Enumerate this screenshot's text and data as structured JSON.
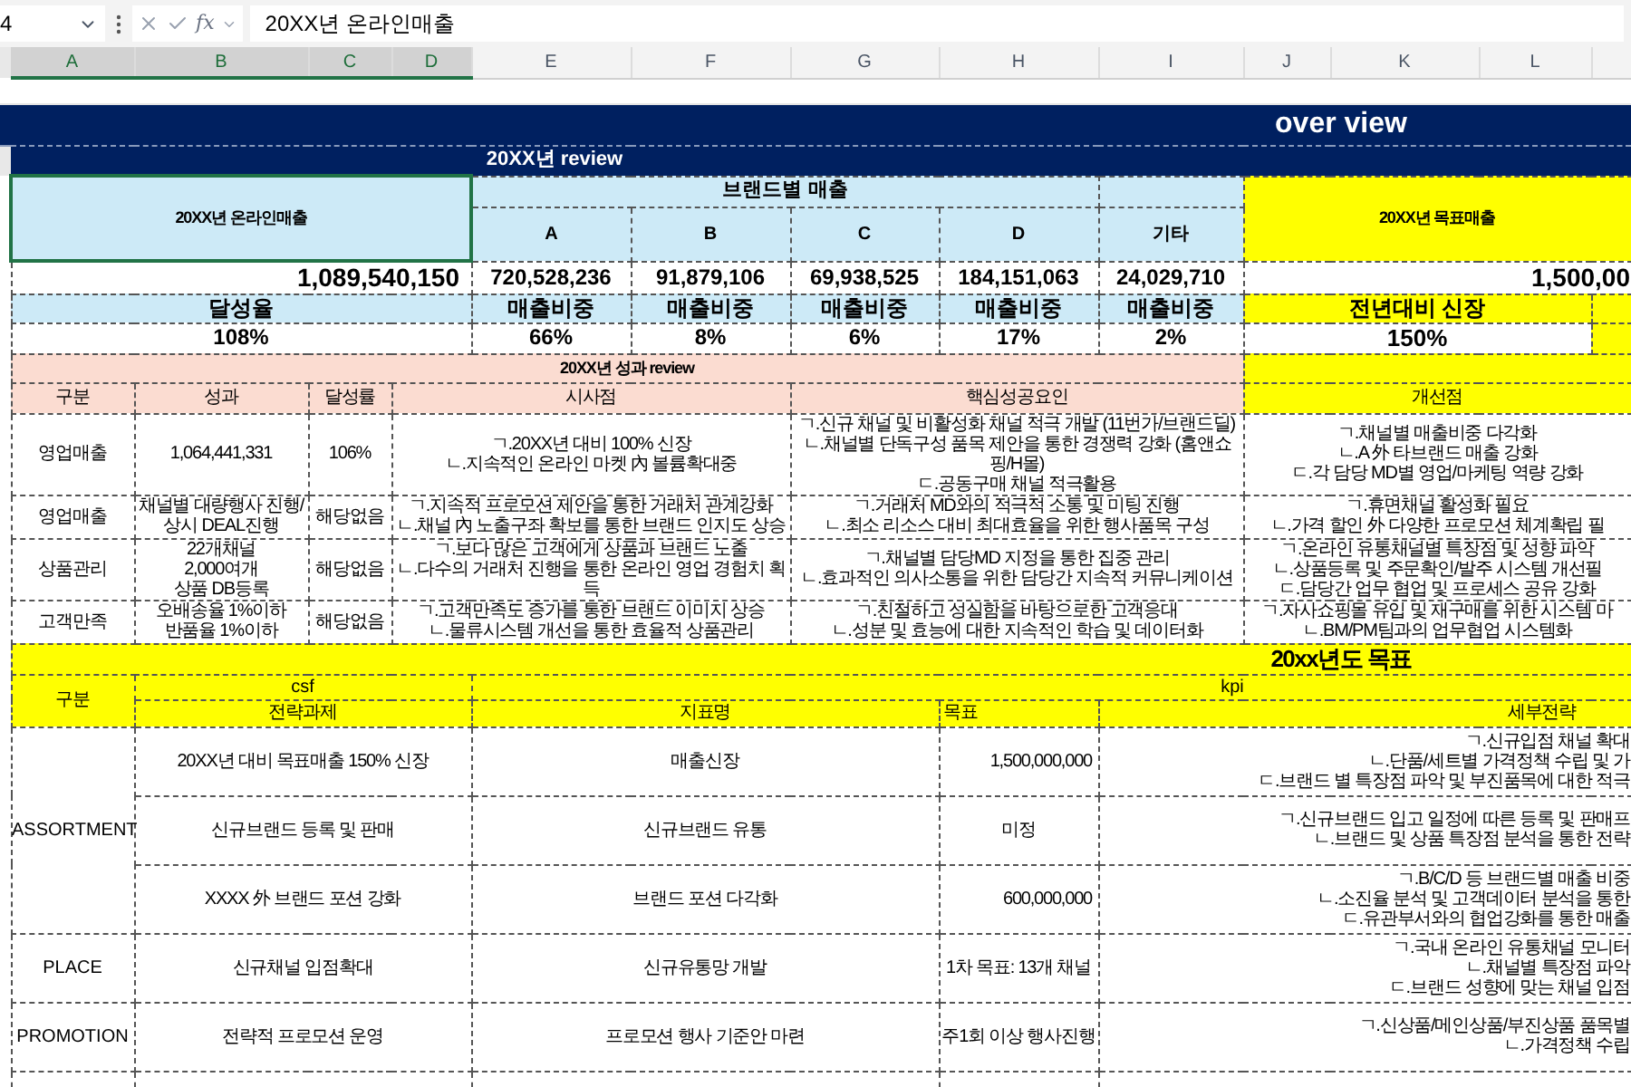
{
  "formula_bar": {
    "name_box": "4",
    "function_label": "fx",
    "formula": "20XX년 온라인매출"
  },
  "columns": [
    {
      "label": "A",
      "selected": true
    },
    {
      "label": "B",
      "selected": true
    },
    {
      "label": "C",
      "selected": true
    },
    {
      "label": "D",
      "selected": true
    },
    {
      "label": "E",
      "selected": false
    },
    {
      "label": "F",
      "selected": false
    },
    {
      "label": "G",
      "selected": false
    },
    {
      "label": "H",
      "selected": false
    },
    {
      "label": "I",
      "selected": false
    },
    {
      "label": "J",
      "selected": false
    },
    {
      "label": "K",
      "selected": false
    },
    {
      "label": "L",
      "selected": false
    }
  ],
  "overview": {
    "title": "over view"
  },
  "review": {
    "title": "20XX년 review",
    "sales_label": {
      "text": "20XX년 온라인매출",
      "selected": true
    },
    "brand_group": "브랜드별 매출",
    "total_sales": "1,089,540,150",
    "achievement_label": "달성율",
    "achievement": "108%",
    "target_label": "20XX년 목표매출",
    "target_sales": "1,500,00",
    "growth_label": "전년대비 신장",
    "growth": "150%",
    "brands": [
      {
        "name": "A",
        "sales": "720,528,236",
        "share_label": "매출비중",
        "share": "66%"
      },
      {
        "name": "B",
        "sales": "91,879,106",
        "share_label": "매출비중",
        "share": "8%"
      },
      {
        "name": "C",
        "sales": "69,938,525",
        "share_label": "매출비중",
        "share": "6%"
      },
      {
        "name": "D",
        "sales": "184,151,063",
        "share_label": "매출비중",
        "share": "17%"
      },
      {
        "name": "기타",
        "sales": "24,029,710",
        "share_label": "매출비중",
        "share": "2%"
      }
    ]
  },
  "performance": {
    "title": "20XX년 성과 review",
    "columns": [
      "구분",
      "성과",
      "달성률",
      "시사점",
      "핵심성공요인",
      "개선점"
    ],
    "rows": [
      {
        "category": "영업매출",
        "result": [
          "1,064,441,331"
        ],
        "rate": "106%",
        "implications": [
          "ㄱ.20XX년 대비 100% 신장",
          "ㄴ.지속적인 온라인 마켓 內 볼륨확대중"
        ],
        "success_factors": [
          "ㄱ.신규 채널 및 비활성화 채널  적극 개발 (11번가/브랜드딜)",
          "ㄴ.채널별 단독구성 품목 제안을 통한 경쟁력 강화 (홈앤쇼핑/H몰)",
          "ㄷ.공동구매 채널 적극활용"
        ],
        "improvements": [
          "ㄱ.채널별 매출비중 다각화",
          "ㄴ.A 外 타브랜드 매출 강화",
          "ㄷ.각 담당 MD별 영업/마케팅 역량 강화"
        ]
      },
      {
        "category": "영업매출",
        "result": [
          "채널별 대량행사 진행/",
          "상시 DEAL진행"
        ],
        "rate": "해당없음",
        "implications": [
          "ㄱ.지속적 프로모션 제안을 통한 거래처 관계강화",
          "ㄴ.채널 內 노출구좌 확보를 통한 브랜드 인지도 상승"
        ],
        "success_factors": [
          "ㄱ.거래처 MD와의 적극적 소통 및 미팅 진행",
          "ㄴ.최소 리소스 대비 최대효율을 위한 행사품목 구성"
        ],
        "improvements": [
          "ㄱ.휴면채널 활성화 필요",
          "ㄴ.가격 할인 外 다양한 프로모션 체계확립 필"
        ]
      },
      {
        "category": "상품관리",
        "result": [
          "22개채널",
          "2,000여개",
          "상품 DB등록"
        ],
        "rate": "해당없음",
        "implications": [
          "ㄱ.보다 많은 고객에게 상품과 브랜드 노출",
          "ㄴ.다수의 거래처 진행을 통한 온라인 영업 경험치 획득"
        ],
        "success_factors": [
          "ㄱ.채널별 담당MD 지정을 통한 집중 관리",
          "ㄴ.효과적인 의사소통을 위한 담당간 지속적 커뮤니케이션"
        ],
        "improvements": [
          "ㄱ.온라인 유통채널별 특장점 및 성향 파악",
          "ㄴ.상품등록 및 주문확인/발주 시스템 개선필",
          "ㄷ.담당간 업무 협업 및 프로세스 공유 강화"
        ]
      },
      {
        "category": "고객만족",
        "result": [
          "오배송율 1%이하",
          "반품율 1%이하"
        ],
        "rate": "해당없음",
        "implications": [
          "ㄱ.고객만족도 증가를 통한 브랜드 이미지 상승",
          "ㄴ.물류시스템 개선을 통한 효율적 상품관리"
        ],
        "success_factors": [
          "ㄱ.친절하고 성실함을 바탕으로한 고객응대",
          "ㄴ.성분 및 효능에 대한 지속적인 학습 및 데이터화"
        ],
        "improvements": [
          "ㄱ.자사쇼핑몰 유입 및 재구매를 위한 시스템 마",
          "ㄴ.BM/PM팀과의 업무협업 시스템화"
        ]
      }
    ]
  },
  "goals": {
    "title": "20xx년도 목표",
    "category_header": "구분",
    "csf_header": "csf",
    "kpi_header": "kpi",
    "columns": [
      "전략과제",
      "지표명",
      "목표",
      "세부전략"
    ],
    "groups": [
      {
        "category": "ASSORTMENT",
        "rows": [
          {
            "task": "20XX년 대비 목표매출 150% 신장",
            "indicator": "매출신장",
            "target": "1,500,000,000",
            "kind": "number",
            "strategies": [
              "ㄱ.신규입점 채널 확대",
              "ㄴ.단품/세트별 가격정책 수립 및 가",
              "ㄷ.브랜드 별 특장점 파악 및 부진품목에 대한 적극"
            ]
          },
          {
            "task": "신규브랜드 등록 및 판매",
            "indicator": "신규브랜드 유통",
            "target": "미정",
            "kind": "text",
            "strategies": [
              "ㄱ.신규브랜드 입고 일정에 따른 등록 및 판매프",
              "ㄴ.브랜드 및 상품 특장점 분석을 통한 전략"
            ]
          },
          {
            "task": "XXXX 外 브랜드 포션 강화",
            "indicator": "브랜드 포션 다각화",
            "target": "600,000,000",
            "kind": "number",
            "strategies": [
              "ㄱ.B/C/D 등 브랜드별 매출 비중",
              "ㄴ.소진율 분석 및 고객데이터 분석을 통한",
              "ㄷ.유관부서와의 협업강화를 통한 매출"
            ]
          }
        ]
      },
      {
        "category": "PLACE",
        "rows": [
          {
            "task": "신규채널 입점확대",
            "indicator": "신규유통망 개발",
            "target": "1차 목표: 13개 채널",
            "kind": "text",
            "strategies": [
              "ㄱ.국내 온라인 유통채널 모니터",
              "ㄴ.채널별 특장점 파악",
              "ㄷ.브랜드 성향에 맞는 채널 입점"
            ]
          }
        ]
      },
      {
        "category": "PROMOTION",
        "rows": [
          {
            "task": "전략적 프로모션 운영",
            "indicator": "프로모션 행사 기준안 마련",
            "target": "주1회 이상 행사진행",
            "kind": "text",
            "strategies": [
              "ㄱ.신상품/메인상품/부진상품 품목별",
              "ㄴ.가격정책 수립"
            ]
          }
        ]
      }
    ]
  }
}
